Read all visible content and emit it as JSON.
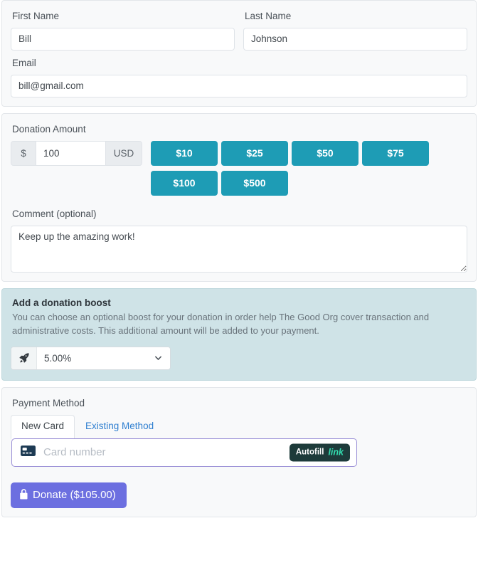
{
  "donor": {
    "first_name_label": "First Name",
    "first_name_value": "Bill",
    "last_name_label": "Last Name",
    "last_name_value": "Johnson",
    "email_label": "Email",
    "email_value": "bill@gmail.com"
  },
  "donation": {
    "amount_label": "Donation Amount",
    "currency_symbol": "$",
    "amount_value": "100",
    "currency_code": "USD",
    "preset_buttons": [
      "$10",
      "$25",
      "$50",
      "$75",
      "$100",
      "$500"
    ],
    "comment_label": "Comment (optional)",
    "comment_value": "Keep up the amazing work!"
  },
  "boost": {
    "title": "Add a donation boost",
    "description": "You can choose an optional boost for your donation in order help The Good Org cover transaction and administrative costs. This additional amount will be added to your payment.",
    "selected_value": "5.00%",
    "icon": "rocket-icon"
  },
  "payment": {
    "section_label": "Payment Method",
    "tabs": [
      {
        "label": "New Card",
        "active": true
      },
      {
        "label": "Existing Method",
        "active": false
      }
    ],
    "card_number_placeholder": "Card number",
    "card_icon": "credit-card-icon",
    "autofill_text": "Autofill",
    "autofill_brand": "link",
    "donate_label": "Donate ($105.00)",
    "donate_icon": "lock-icon"
  },
  "colors": {
    "amount_button": "#1e9cb5",
    "donate_button": "#6c6fe0",
    "boost_panel": "#cfe3e7",
    "autofill_badge": "#1d3b3a",
    "autofill_brand": "#33ddb0",
    "tab_link": "#2f7fd0"
  }
}
